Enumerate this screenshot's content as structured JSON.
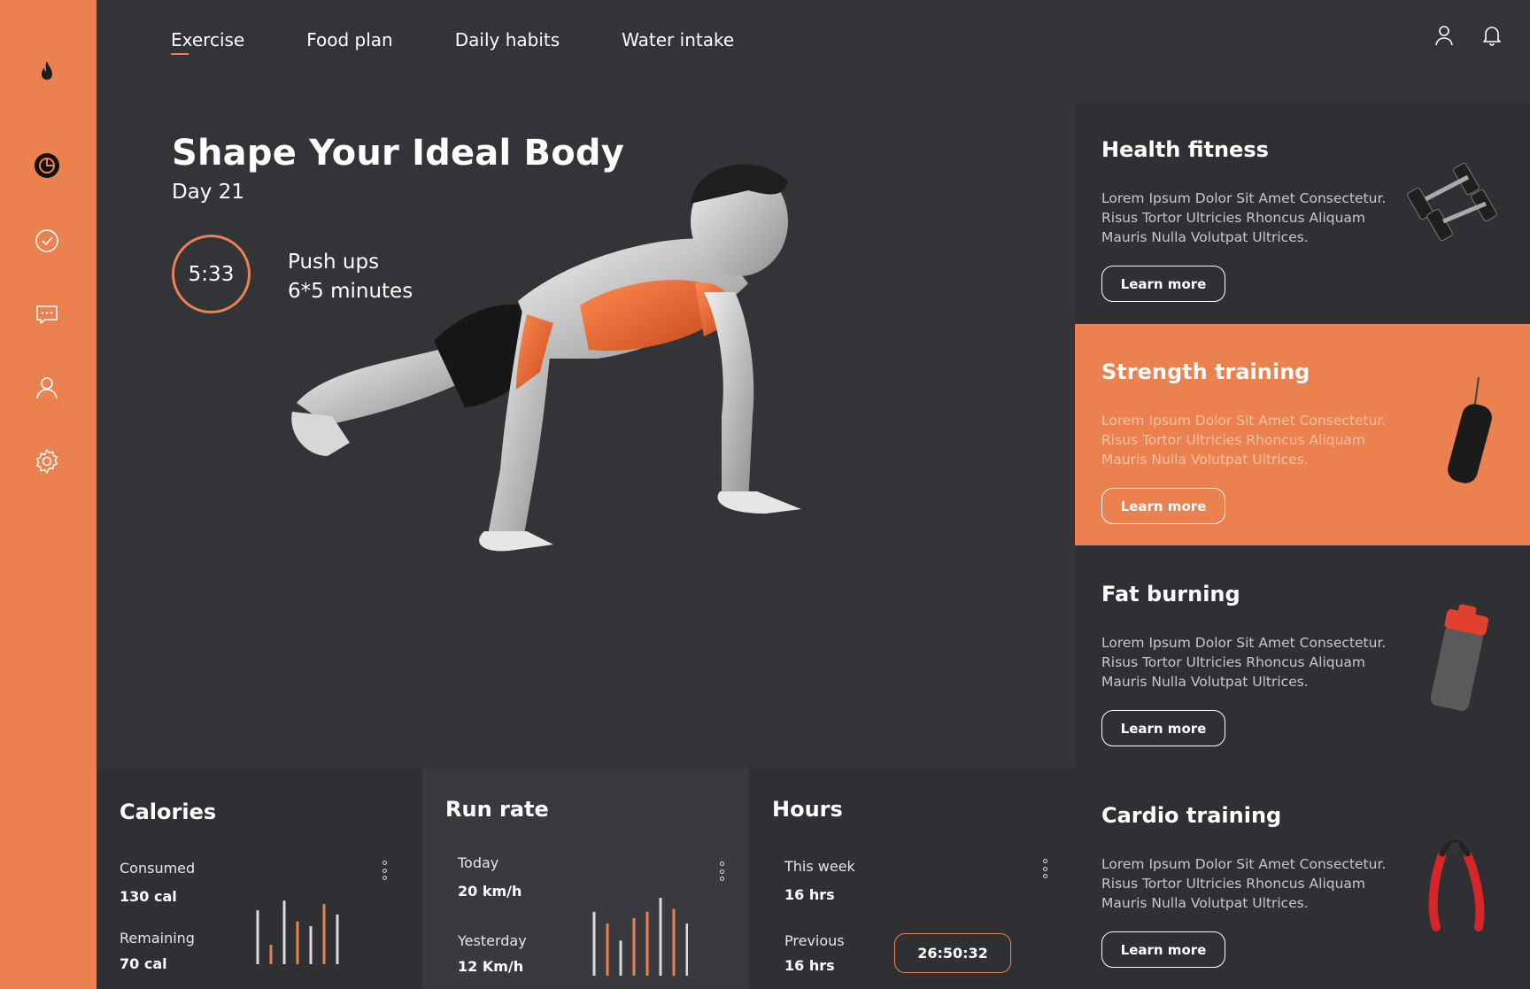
{
  "nav": {
    "items": [
      "Exercise",
      "Food plan",
      "Daily habits",
      "Water intake"
    ],
    "active_index": 0
  },
  "sidebar": {
    "icons": [
      "flame-logo-icon",
      "pie-chart-icon",
      "check-circle-icon",
      "chat-icon",
      "user-icon",
      "settings-icon"
    ]
  },
  "header_icons": [
    "user-icon",
    "bell-icon"
  ],
  "hero": {
    "title": "Shape Your Ideal Body",
    "day": "Day 21",
    "timer": "5:33",
    "exercise": "Push ups",
    "duration": "6*5 minutes"
  },
  "cards": [
    {
      "title": "Health fitness",
      "text": "Lorem Ipsum Dolor Sit Amet Consectetur. Risus Tortor Ultricies Rhoncus Aliquam Mauris Nulla Volutpat Ultrices.",
      "button": "Learn more",
      "image": "dumbbells"
    },
    {
      "title": "Strength training",
      "text": "Lorem Ipsum Dolor Sit Amet Consectetur. Risus Tortor Ultricies Rhoncus Aliquam Mauris Nulla Volutpat Ultrices.",
      "button": "Learn more",
      "image": "punching-bag"
    },
    {
      "title": "Fat burning",
      "text": "Lorem Ipsum Dolor Sit Amet Consectetur. Risus Tortor Ultricies Rhoncus Aliquam Mauris Nulla Volutpat Ultrices.",
      "button": "Learn more",
      "image": "shaker-bottle"
    },
    {
      "title": "Cardio training",
      "text": "Lorem Ipsum Dolor Sit Amet Consectetur. Risus Tortor Ultricies Rhoncus Aliquam Mauris Nulla Volutpat Ultrices.",
      "button": "Learn more",
      "image": "hand-grip"
    }
  ],
  "stats": {
    "calories": {
      "title": "Calories",
      "row1_label": "Consumed",
      "row1_value": "130 cal",
      "row2_label": "Remaining",
      "row2_value": "70 cal",
      "bars": [
        0.78,
        0.28,
        0.92,
        0.62,
        0.55,
        0.87,
        0.72
      ],
      "bar_colors": [
        "#D9DADC",
        "#EC8150",
        "#D9DADC",
        "#EC8150",
        "#D9DADC",
        "#EC8150",
        "#D9DADC"
      ]
    },
    "run_rate": {
      "title": "Run rate",
      "row1_label": "Today",
      "row1_value": "20 km/h",
      "row2_label": "Yesterday",
      "row2_value": "12 Km/h",
      "bars": [
        0.82,
        0.67,
        0.45,
        0.74,
        0.82,
        1.0,
        0.86,
        0.67
      ],
      "bar_colors": [
        "#D9DADC",
        "#EC8150",
        "#D9DADC",
        "#EC8150",
        "#EC8150",
        "#D9DADC",
        "#EC8150",
        "#D9DADC"
      ]
    },
    "hours": {
      "title": "Hours",
      "row1_label": "This week",
      "row1_value": "16 hrs",
      "row2_label": "Previous",
      "row2_value": "16 hrs",
      "badge": "26:50:32"
    }
  },
  "colors": {
    "accent": "#EC8150",
    "background": "#333438",
    "card": "#2F3034"
  }
}
